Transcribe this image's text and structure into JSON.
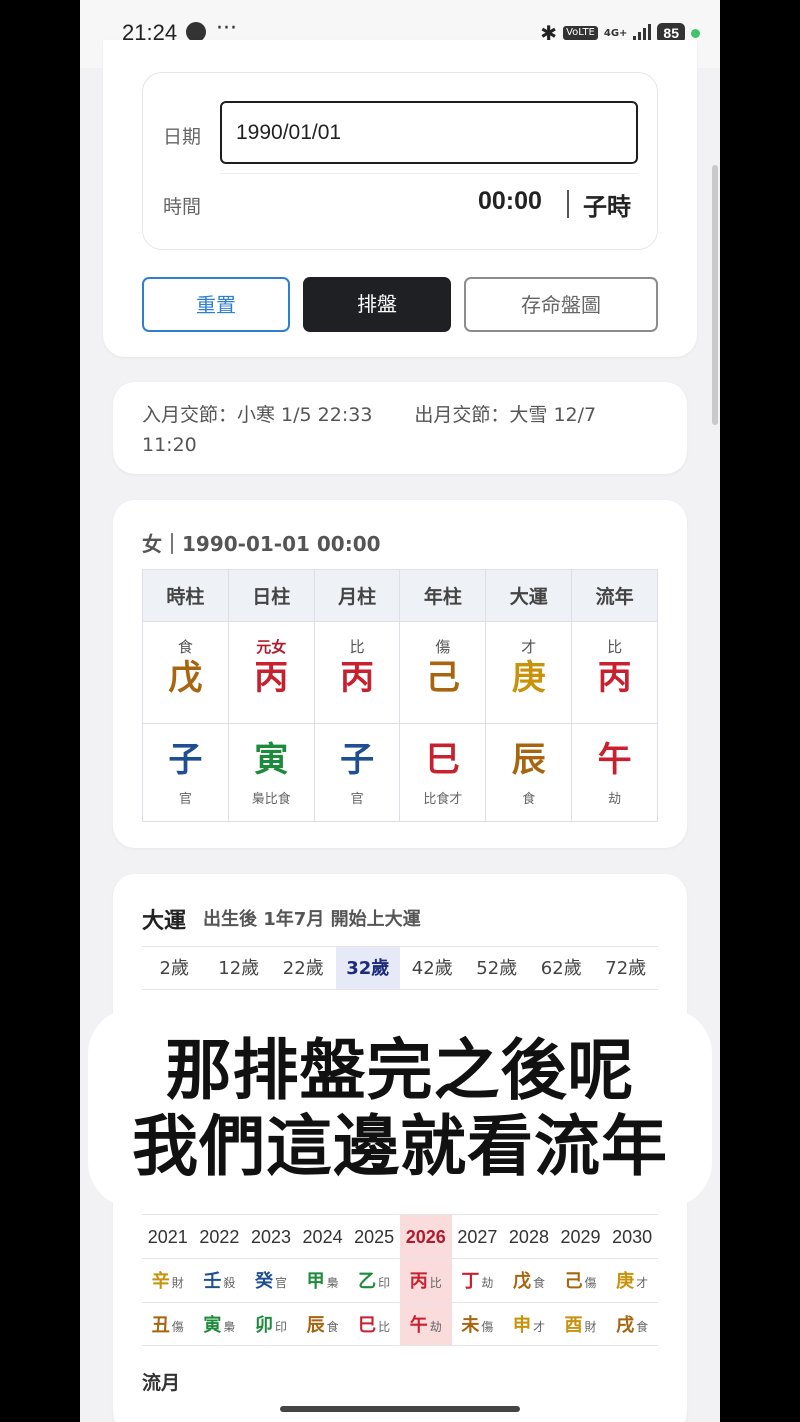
{
  "status": {
    "time": "21:24",
    "dots": "···",
    "bluetooth": "✱",
    "volte": "VoLTE",
    "network": "4G+",
    "battery": "85"
  },
  "form": {
    "date_label": "日期",
    "date_value": "1990/01/01",
    "time_label": "時間",
    "time_value": "00:00",
    "time_hour": "子時",
    "reset_label": "重置",
    "pan_label": "排盤",
    "save_label": "存命盤圖"
  },
  "jieqi": {
    "enter": "入月交節：小寒 1/5 22:33",
    "exit": "出月交節：大雪 12/7",
    "exit_time": "11:20"
  },
  "chart": {
    "header": "女｜1990-01-01 00:00",
    "columns": [
      "時柱",
      "日柱",
      "月柱",
      "年柱",
      "大運",
      "流年"
    ],
    "stem_gods": [
      "食",
      "元女",
      "比",
      "傷",
      "才",
      "比"
    ],
    "stems": [
      "戊",
      "丙",
      "丙",
      "己",
      "庚",
      "丙"
    ],
    "branches": [
      "子",
      "寅",
      "子",
      "巳",
      "辰",
      "午"
    ],
    "hidden": [
      "官",
      "梟比食",
      "官",
      "比食才",
      "食",
      "劫"
    ]
  },
  "dayun": {
    "title": "大運",
    "subtitle": "出生後 1年7月 開始上大運",
    "ages": [
      "2歲",
      "12歲",
      "22歲",
      "32歲",
      "42歲",
      "52歲",
      "62歲",
      "72歲"
    ],
    "selected_index": 3
  },
  "caption": {
    "line1": "那排盤完之後呢",
    "line2": "我們這邊就看流年"
  },
  "liunian": {
    "years": [
      "2021",
      "2022",
      "2023",
      "2024",
      "2025",
      "2026",
      "2027",
      "2028",
      "2029",
      "2030"
    ],
    "current_index": 5,
    "stems": [
      [
        "辛",
        "財"
      ],
      [
        "壬",
        "殺"
      ],
      [
        "癸",
        "官"
      ],
      [
        "甲",
        "梟"
      ],
      [
        "乙",
        "印"
      ],
      [
        "丙",
        "比"
      ],
      [
        "丁",
        "劫"
      ],
      [
        "戊",
        "食"
      ],
      [
        "己",
        "傷"
      ],
      [
        "庚",
        "才"
      ]
    ],
    "branches": [
      [
        "丑",
        "傷"
      ],
      [
        "寅",
        "梟"
      ],
      [
        "卯",
        "印"
      ],
      [
        "辰",
        "食"
      ],
      [
        "巳",
        "比"
      ],
      [
        "午",
        "劫"
      ],
      [
        "未",
        "傷"
      ],
      [
        "申",
        "才"
      ],
      [
        "酉",
        "財"
      ],
      [
        "戌",
        "食"
      ]
    ]
  },
  "liuyue_label": "流月",
  "colors": {
    "earth": "#a8650f",
    "fire": "#c8202e",
    "metal": "#c8920a",
    "water": "#1e4f92",
    "wood": "#1e8a3c",
    "accent_blue": "#2f7fd0"
  }
}
